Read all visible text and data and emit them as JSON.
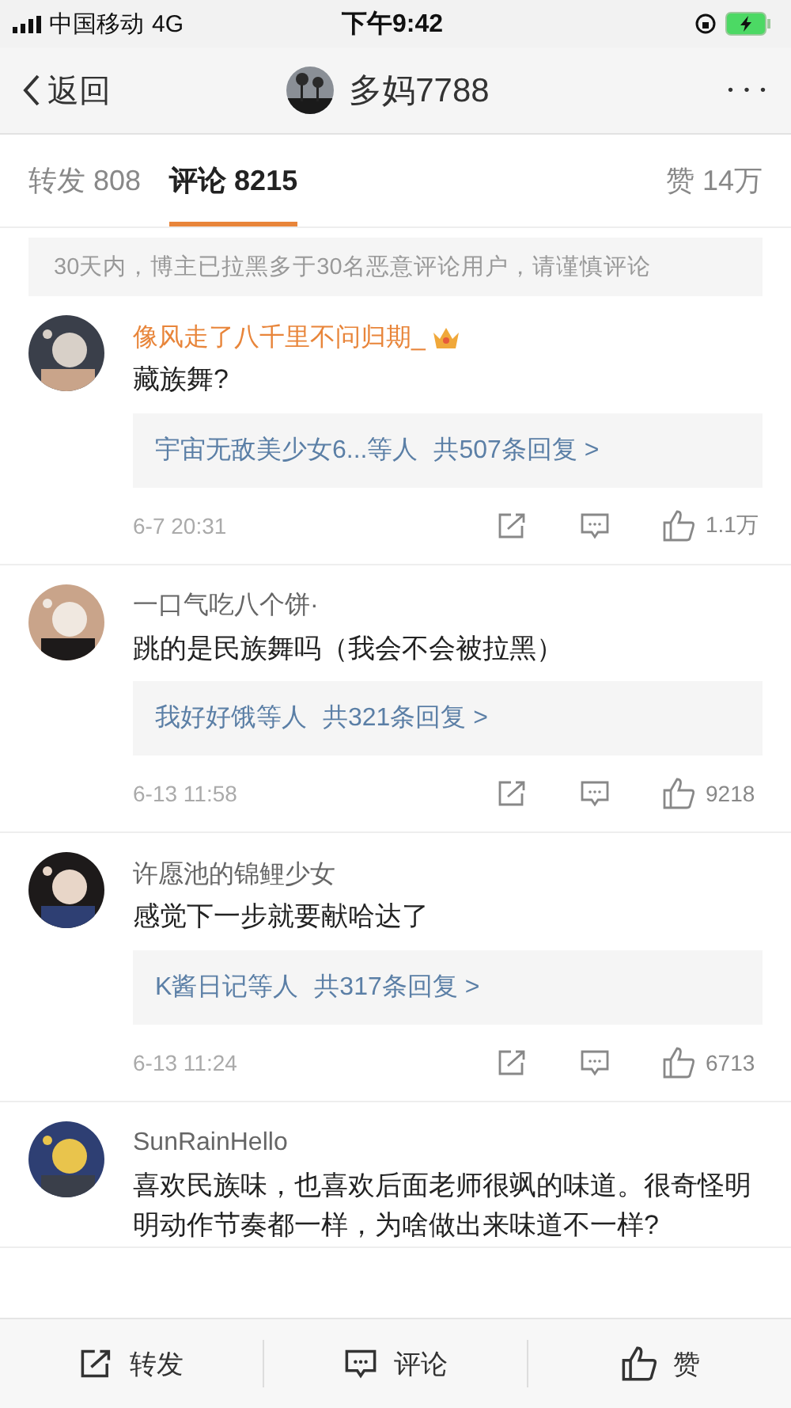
{
  "status_bar": {
    "carrier": "中国移动",
    "network": "4G",
    "time": "下午9:42"
  },
  "nav": {
    "back": "返回",
    "title": "多妈7788",
    "more": "• • •"
  },
  "tabs": [
    {
      "label": "转发 808",
      "selected": false
    },
    {
      "label": "评论 8215",
      "selected": true
    }
  ],
  "likes_tab": "赞 14万",
  "notice": "30天内，博主已拉黑多于30名恶意评论用户，请谨慎评论",
  "comments": [
    {
      "name": "像风走了八千里不问归期_",
      "vip": true,
      "text": "藏族舞?",
      "replies": {
        "users": "宇宙无敌美少女6...等人",
        "count": "共507条回复 >"
      },
      "time": "6-7 20:31",
      "likes": "1.1万"
    },
    {
      "name": "一口气吃八个饼·",
      "vip": false,
      "text": "跳的是民族舞吗（我会不会被拉黑）",
      "replies": {
        "users": "我好好饿等人",
        "count": "共321条回复 >"
      },
      "time": "6-13 11:58",
      "likes": "9218"
    },
    {
      "name": "许愿池的锦鲤少女",
      "vip": false,
      "text": "感觉下一步就要献哈达了",
      "replies": {
        "users": "K酱日记等人",
        "count": "共317条回复 >"
      },
      "time": "6-13 11:24",
      "likes": "6713"
    },
    {
      "name": "SunRainHello",
      "vip": false,
      "text": "喜欢民族味，也喜欢后面老师很飒的味道。很奇怪明明动作节奏都一样，为啥做出来味道不一样?"
    }
  ],
  "bottom_bar": [
    {
      "kind": "repost",
      "label": "转发"
    },
    {
      "kind": "comment",
      "label": "评论"
    },
    {
      "kind": "like",
      "label": "赞"
    }
  ]
}
